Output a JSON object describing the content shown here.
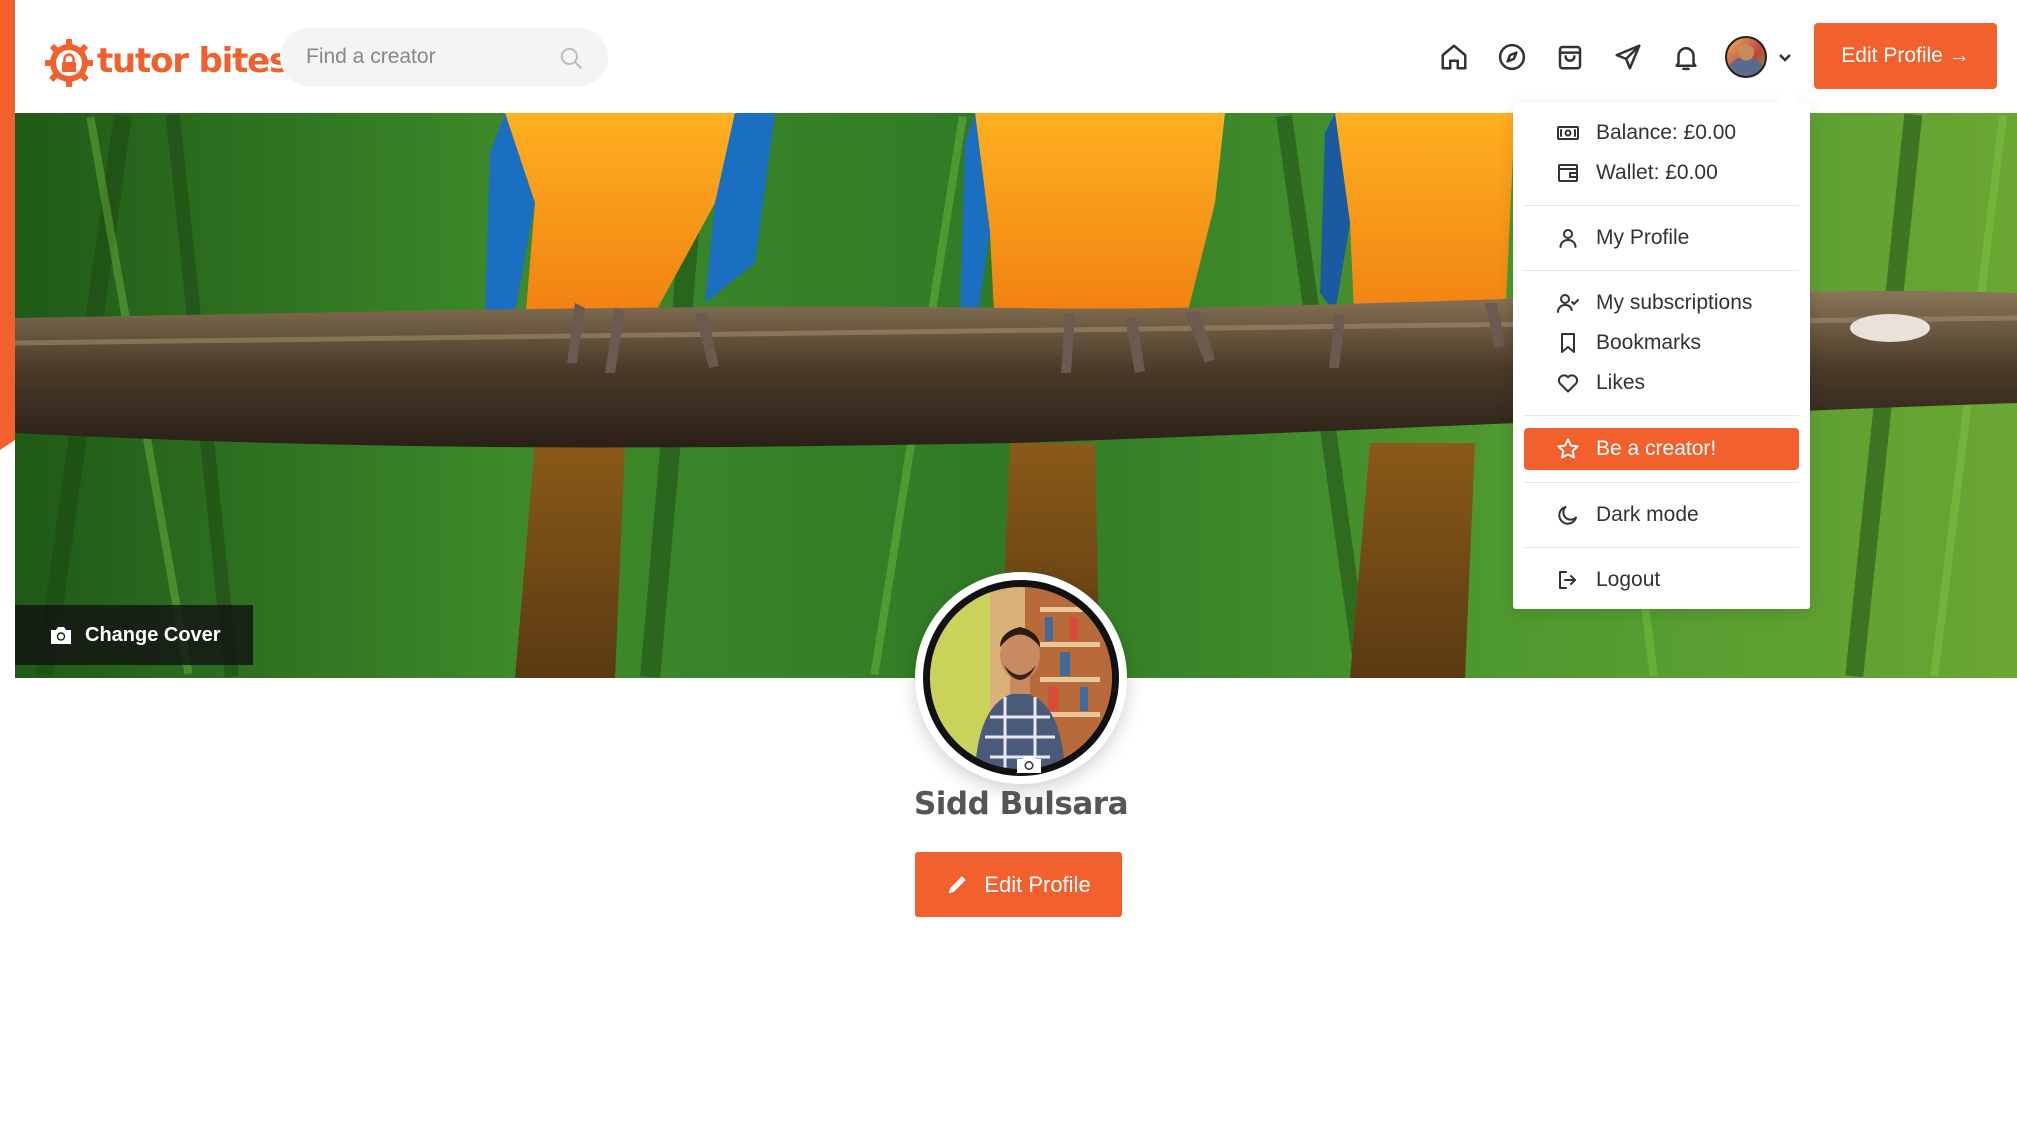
{
  "brand": {
    "name": "tutor bites",
    "color": "#f2612d"
  },
  "search": {
    "placeholder": "Find a creator"
  },
  "nav": {
    "icons": [
      "home-icon",
      "compass-icon",
      "shopping-bag-icon",
      "send-icon",
      "bell-icon"
    ],
    "edit_profile_label": "Edit Profile →"
  },
  "cover": {
    "change_cover_label": "Change Cover"
  },
  "profile": {
    "name": "Sidd Bulsara",
    "edit_label": "Edit Profile"
  },
  "menu": {
    "balance": "Balance: £0.00",
    "wallet": "Wallet: £0.00",
    "my_profile": "My Profile",
    "subscriptions": "My subscriptions",
    "bookmarks": "Bookmarks",
    "likes": "Likes",
    "be_creator": "Be a creator!",
    "dark_mode": "Dark mode",
    "logout": "Logout"
  }
}
